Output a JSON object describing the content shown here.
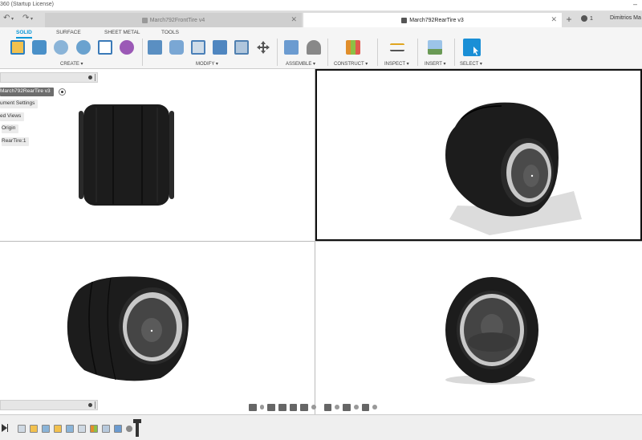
{
  "window": {
    "title_partial": "360 (Startup License)",
    "minimize_glyph": "–"
  },
  "quick_access": {
    "undo_glyph": "↶",
    "redo_glyph": "↷"
  },
  "tabs": [
    {
      "label": "March792FrontTire v4",
      "active": false,
      "close_glyph": "✕"
    },
    {
      "label": "March792RearTire v3",
      "active": true,
      "close_glyph": "✕"
    }
  ],
  "new_tab_glyph": "+",
  "notifications": {
    "count": "1"
  },
  "user": {
    "name_partial": "Dimitrios Ma"
  },
  "ribbon": {
    "tabs": [
      "SOLID",
      "SURFACE",
      "SHEET METAL",
      "TOOLS"
    ],
    "active_tab": "SOLID",
    "groups": [
      {
        "label": "CREATE ▾"
      },
      {
        "label": "MODIFY ▾"
      },
      {
        "label": "ASSEMBLE ▾"
      },
      {
        "label": "CONSTRUCT ▾"
      },
      {
        "label": "INSPECT ▾"
      },
      {
        "label": "INSERT ▾"
      },
      {
        "label": "SELECT ▾"
      }
    ],
    "accent_color": "#0696d7"
  },
  "browser": {
    "root": "March792RearTire v3",
    "items": [
      "ument Settings",
      "ed Views",
      "Origin",
      "RearTire:1"
    ]
  },
  "viewports": [
    {
      "view": "front-view-tire"
    },
    {
      "view": "iso-view-tire",
      "active": true
    },
    {
      "view": "perspective-view-tire"
    },
    {
      "view": "side-view-tire"
    }
  ],
  "colors": {
    "tire": "#1c1c1c",
    "rim": "#c8c8c8",
    "shadow": "#d9d9d9"
  }
}
